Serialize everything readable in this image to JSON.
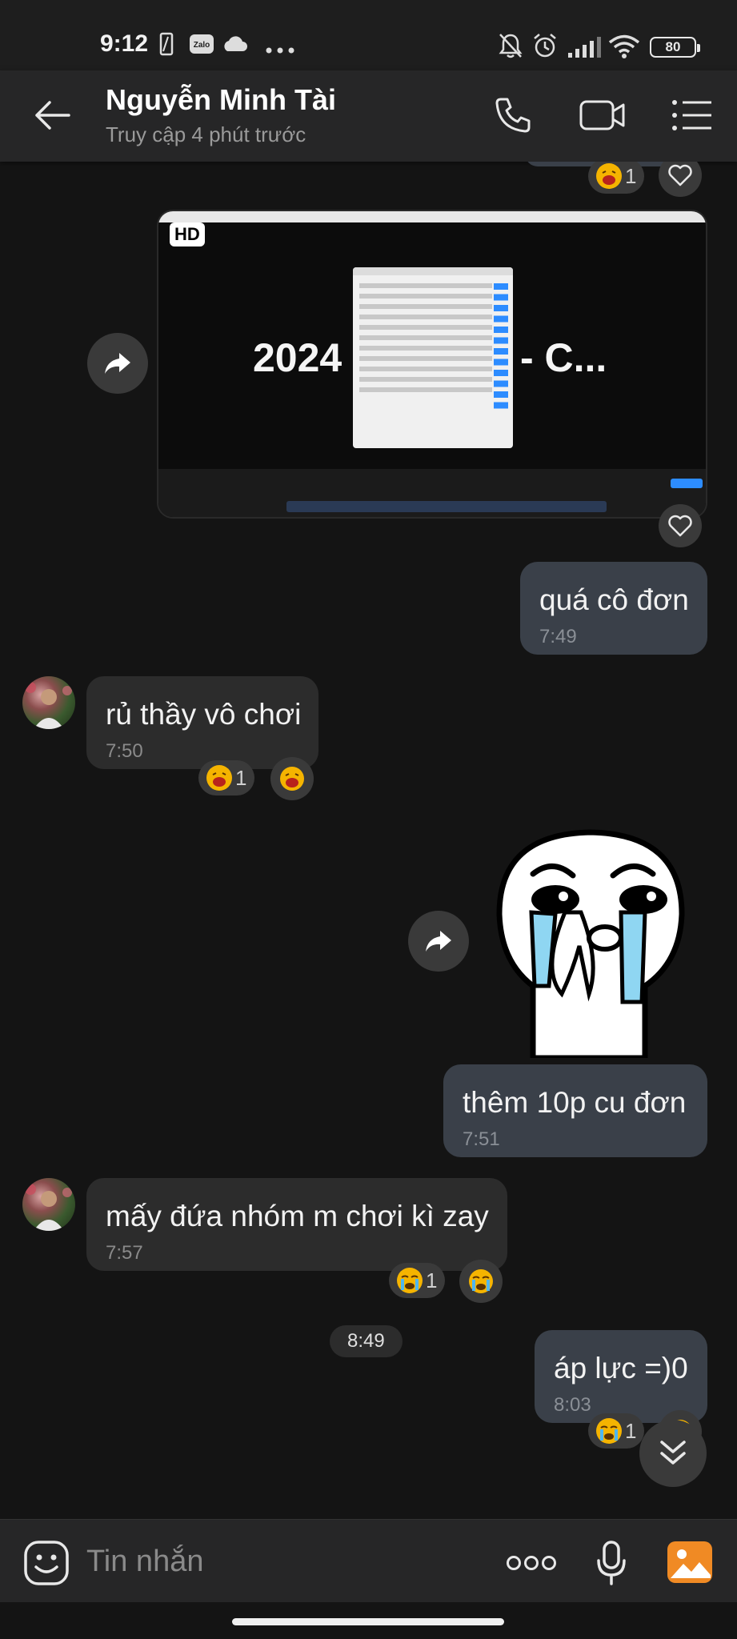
{
  "status_bar": {
    "time": "9:12",
    "battery": "80"
  },
  "header": {
    "contact_name": "Nguyễn Minh Tài",
    "status": "Truy cập 4 phút trước"
  },
  "messages": [
    {
      "direction": "out",
      "text": "quá cô đơn",
      "time": "7:49"
    },
    {
      "direction": "in",
      "text": "rủ thầy vô chơi",
      "time": "7:50",
      "reaction": {
        "emoji": "laughing-face",
        "count": "1"
      }
    },
    {
      "direction": "out",
      "type": "sticker",
      "sticker": "crying-character-sticker"
    },
    {
      "direction": "out",
      "text": "thêm 10p cu đơn",
      "time": "7:51"
    },
    {
      "direction": "in",
      "text": "mấy đứa nhóm m chơi kì zay",
      "time": "7:57",
      "reaction": {
        "emoji": "crying-face",
        "count": "1"
      }
    },
    {
      "direction": "out",
      "text": "áp lực =)0",
      "time": "8:03",
      "reaction": {
        "emoji": "crying-face",
        "count": "1"
      }
    }
  ],
  "video": {
    "badge": "HD",
    "title_left": "2024",
    "title_right": "- C..."
  },
  "top_reaction": {
    "count": "1"
  },
  "time_separator": "8:49",
  "input": {
    "placeholder": "Tin nhắn"
  },
  "colors": {
    "background": "#141414",
    "header": "#262627",
    "bubble_out": "#3a4049",
    "bubble_in": "#2c2c2c",
    "accent_gallery": "#f08a24"
  }
}
